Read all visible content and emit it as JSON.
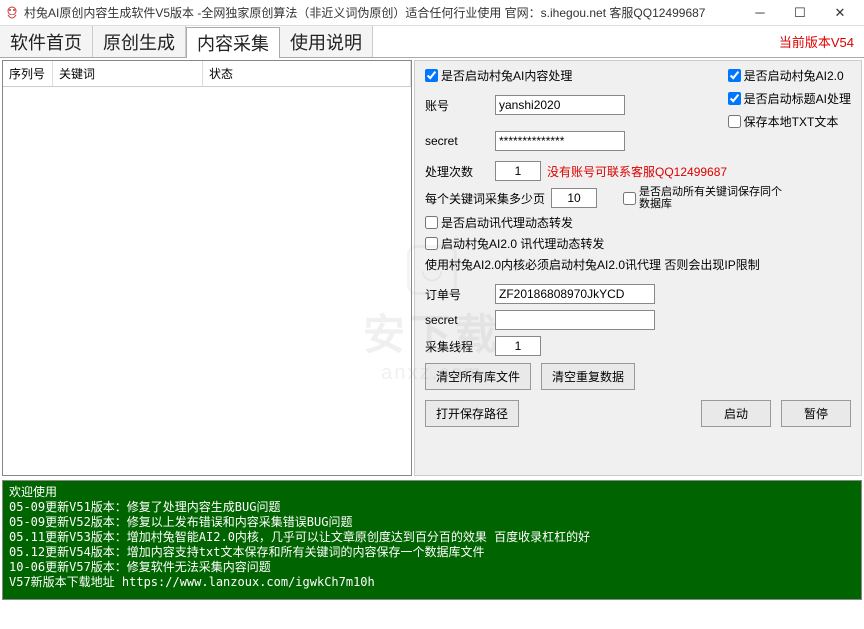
{
  "window": {
    "title": "村兔AI原创内容生成软件V5版本 -全网独家原创算法（非近义词伪原创）适合任何行业使用 官网：s.ihegou.net 客服QQ12499687"
  },
  "tabs": {
    "items": [
      "软件首页",
      "原创生成",
      "内容采集",
      "使用说明"
    ],
    "active": 2
  },
  "version_label": "当前版本V54",
  "table": {
    "headers": [
      "序列号",
      "关键词",
      "状态"
    ]
  },
  "options": {
    "ai_content": {
      "label": "是否启动村兔AI内容处理",
      "checked": true
    },
    "ai20": {
      "label": "是否启动村兔AI2.0",
      "checked": true
    },
    "title_ai": {
      "label": "是否启动标题AI处理",
      "checked": true
    },
    "save_txt": {
      "label": "保存本地TXT文本",
      "checked": false
    },
    "proxy_forward": {
      "label": "是否启动讯代理动态转发",
      "checked": false
    },
    "ai20_proxy": {
      "label": "启动村兔AI2.0 讯代理动态转发",
      "checked": false
    },
    "all_keyword_db": {
      "label": "是否启动所有关键词保存同个数据库",
      "checked": false
    }
  },
  "fields": {
    "account_label": "账号",
    "account_value": "yanshi2020",
    "secret1_label": "secret",
    "secret1_value": "**************",
    "count_label": "处理次数",
    "count_value": "1",
    "no_account_hint": "没有账号可联系客服QQ12499687",
    "pages_label": "每个关键词采集多少页",
    "pages_value": "10",
    "note_ai20": "使用村兔AI2.0内核必须启动村兔AI2.0讯代理 否则会出现IP限制",
    "order_label": "订单号",
    "order_value": "ZF20186808970JkYCD",
    "secret2_label": "secret",
    "secret2_value": "",
    "threads_label": "采集线程",
    "threads_value": "1"
  },
  "buttons": {
    "clear_lib": "清空所有库文件",
    "clear_dup": "清空重复数据",
    "open_path": "打开保存路径",
    "start": "启动",
    "pause": "暂停"
  },
  "log_lines": [
    "欢迎使用",
    "05-09更新V51版本：修复了处理内容生成BUG问题",
    "05-09更新V52版本：修复以上发布错误和内容采集错误BUG问题",
    "05.11更新V53版本：增加村兔智能AI2.0内核，几乎可以让文章原创度达到百分百的效果 百度收录杠杠的好",
    "05.12更新V54版本：增加内容支持txt文本保存和所有关键词的内容保存一个数据库文件",
    "10-06更新V57版本：修复软件无法采集内容问题",
    "V57新版本下载地址 https://www.lanzoux.com/igwkCh7m10h"
  ],
  "watermark": {
    "main": "安下载",
    "sub": "anxz.com"
  }
}
